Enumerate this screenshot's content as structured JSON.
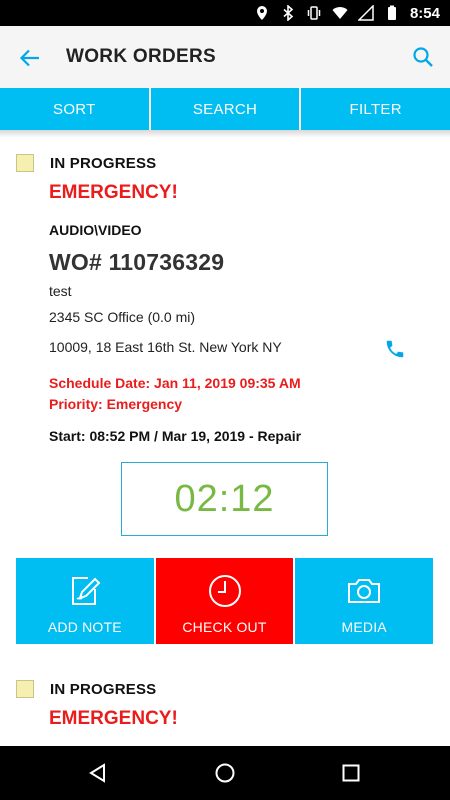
{
  "status_bar": {
    "time": "8:54",
    "icons": [
      "location-icon",
      "bluetooth-icon",
      "vibrate-icon",
      "wifi-icon",
      "signal-icon",
      "battery-icon"
    ]
  },
  "app_bar": {
    "title": "WORK ORDERS",
    "back_icon": "arrow-back-icon",
    "search_icon": "search-icon"
  },
  "tabs": [
    {
      "label": "SORT"
    },
    {
      "label": "SEARCH"
    },
    {
      "label": "FILTER"
    }
  ],
  "work_orders": [
    {
      "status": "IN PROGRESS",
      "emergency": "EMERGENCY!",
      "category": "AUDIO\\VIDEO",
      "wo_number": "WO# 110736329",
      "description": "test",
      "office": "2345 SC Office (0.0 mi)",
      "address": "10009, 18 East 16th St. New York NY",
      "schedule": "Schedule Date: Jan 11, 2019 09:35 AM",
      "priority": "Priority: Emergency",
      "start": "Start: 08:52 PM / Mar 19, 2019 - Repair",
      "timer": "02:12",
      "actions": [
        {
          "label": "ADD NOTE",
          "icon": "add-note-icon"
        },
        {
          "label": "CHECK OUT",
          "icon": "clock-icon"
        },
        {
          "label": "MEDIA",
          "icon": "camera-icon"
        }
      ]
    },
    {
      "status": "IN PROGRESS",
      "emergency": "EMERGENCY!"
    }
  ],
  "colors": {
    "accent": "#00bdf2",
    "emergency": "#ea1c1c",
    "timer": "#78b944",
    "checkout": "#ff0000"
  }
}
